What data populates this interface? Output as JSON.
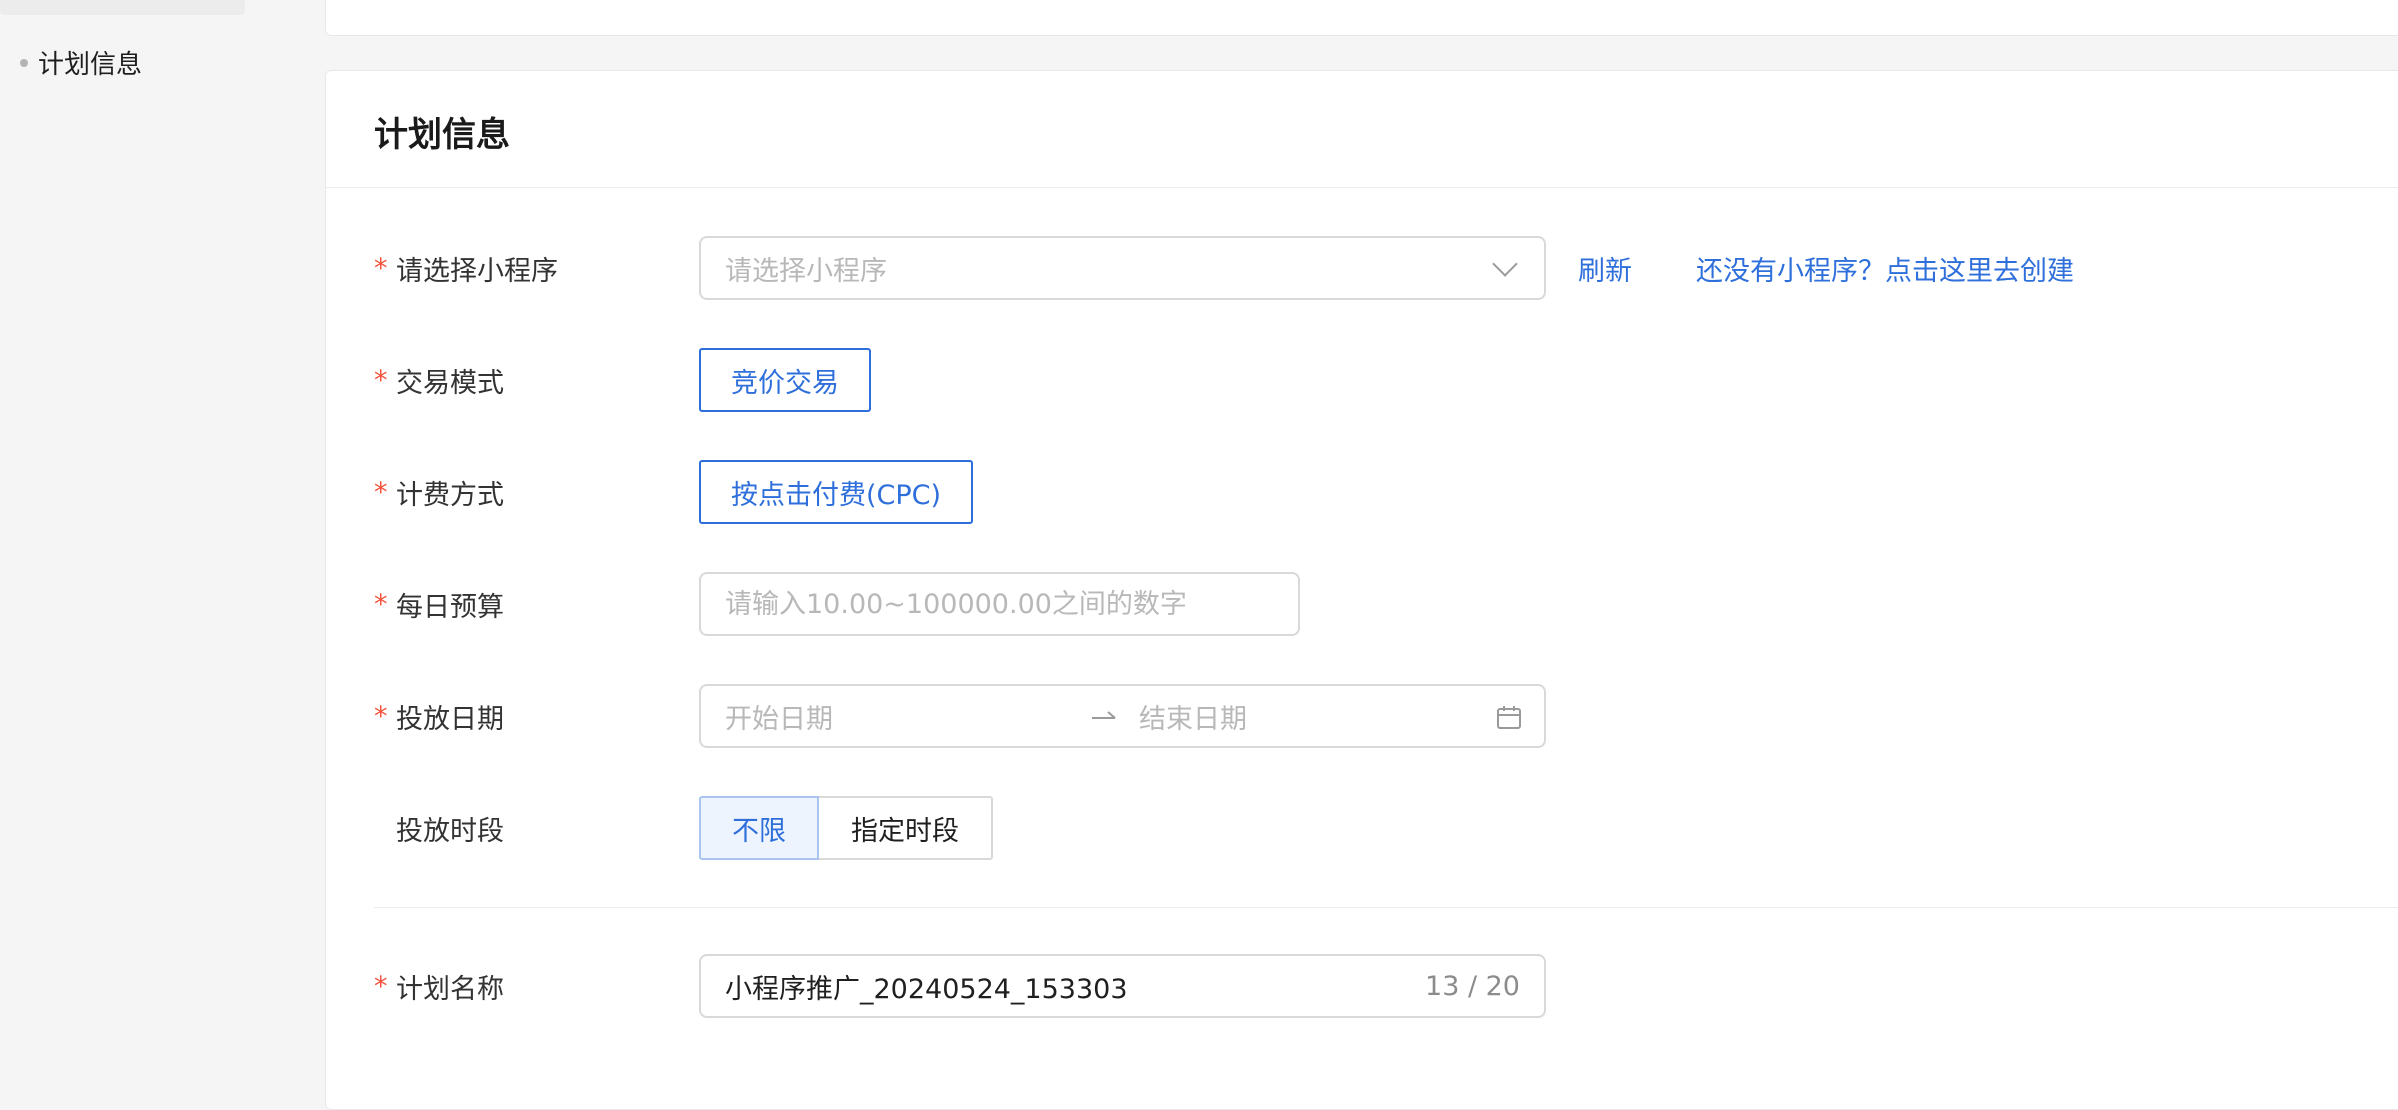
{
  "sidebar": {
    "items": [
      {
        "label": "计划信息"
      }
    ]
  },
  "section": {
    "title": "计划信息"
  },
  "form": {
    "mini_program": {
      "label": "请选择小程序",
      "placeholder": "请选择小程序",
      "refresh_link": "刷新",
      "create_link": "还没有小程序？点击这里去创建"
    },
    "trade_mode": {
      "label": "交易模式",
      "option": "竞价交易"
    },
    "billing": {
      "label": "计费方式",
      "option": "按点击付费(CPC)"
    },
    "daily_budget": {
      "label": "每日预算",
      "placeholder": "请输入10.00~100000.00之间的数字"
    },
    "delivery_date": {
      "label": "投放日期",
      "start_placeholder": "开始日期",
      "end_placeholder": "结束日期"
    },
    "delivery_time": {
      "label": "投放时段",
      "options": [
        "不限",
        "指定时段"
      ],
      "selected": "不限"
    },
    "plan_name": {
      "label": "计划名称",
      "value": "小程序推广_20240524_153303",
      "count": "13 / 20"
    }
  },
  "colors": {
    "accent": "#2e6fdb",
    "required": "#f5533d",
    "border": "#d9d9d9",
    "placeholder": "#b8b8b8"
  },
  "icons": {
    "select_arrow": "chevron-down-icon",
    "date_range_separator": "arrow-right-icon",
    "date_picker": "calendar-icon"
  }
}
